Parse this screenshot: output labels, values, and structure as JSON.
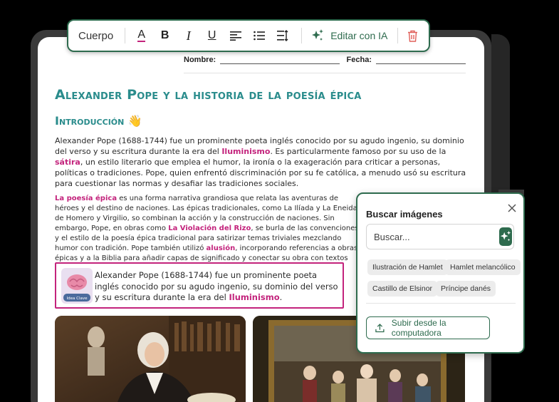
{
  "toolbar": {
    "style_label": "Cuerpo",
    "buttons": [
      {
        "icon": "text-color-icon",
        "glyph": "A"
      },
      {
        "icon": "bold-icon",
        "glyph": "B"
      },
      {
        "icon": "italic-icon",
        "glyph": "I"
      },
      {
        "icon": "underline-icon",
        "glyph": "U"
      },
      {
        "icon": "align-left-icon"
      },
      {
        "icon": "bullet-list-icon"
      },
      {
        "icon": "more-format-icon"
      }
    ],
    "ai_label": "Editar con IA",
    "delete_icon": "trash-icon"
  },
  "document": {
    "name_label": "Nombre:",
    "date_label": "Fecha:",
    "title": "Alexander Pope y la historia de la poesía épica",
    "section": "Introducción",
    "section_emoji": "👋",
    "p1": {
      "a": "Alexander Pope (1688-1744) fue un prominente poeta inglés conocido por su agudo ingenio, su dominio del verso y su escritura durante la era del ",
      "h1": "Iluminismo",
      "b": ". Es particularmente famoso por su uso de la ",
      "h2": "sátira",
      "c": ", un estilo literario que emplea el humor, la ironía o la exageración para criticar a personas, políticas o tradiciones. Pope, quien enfrentó discriminación por su fe católica, a menudo usó su escritura para cuestionar las normas y desafiar las tradiciones sociales."
    },
    "p2": {
      "h1": "La poesía épica",
      "a": " es una forma narrativa grandiosa que relata las aventuras de héroes y el destino de naciones. Las épicas tradicionales, como La Ilíada y La Eneida de Homero y Virgilio, so combinan la acción y la construcción de naciones. Sin embargo, Pope, en obras como ",
      "h2": "La Violación del Rizo",
      "b": ", se burla de las convenciones y el estilo de la poesía épica tradicional para satirizar temas triviales mezclando humor con tradición. Pope también utilizó ",
      "h3": "alusión",
      "c": ", incorporando referencias a obras épicas y a la Biblia para añadir capas de significado y conectar su obra con textos más amplios."
    },
    "callout": {
      "badge_label": "Idea Clave",
      "badge_icon": "brain-icon",
      "text": "Alexander Pope (1688-1744) fue un prominente poeta inglés conocido por su agudo ingenio, su dominio del verso y su escritura durante la era del ",
      "highlight": "Iluminismo",
      "end": "."
    },
    "images": [
      {
        "name": "portrait-image",
        "description": "Retrato de Alexander Pope"
      },
      {
        "name": "painting-image",
        "description": "Pintura de escena de corte"
      }
    ]
  },
  "image_search": {
    "title": "Buscar imágenes",
    "placeholder": "Buscar...",
    "suggestions": [
      "Ilustración de Hamlet",
      "Hamlet melancólico",
      "Castillo de Elsinor",
      "Príncipe danés"
    ],
    "upload_label": "Subir desde la computadora"
  },
  "colors": {
    "accent_green": "#2e6b4e",
    "heading_teal": "#2a8c8c",
    "highlight_magenta": "#c3237c"
  }
}
